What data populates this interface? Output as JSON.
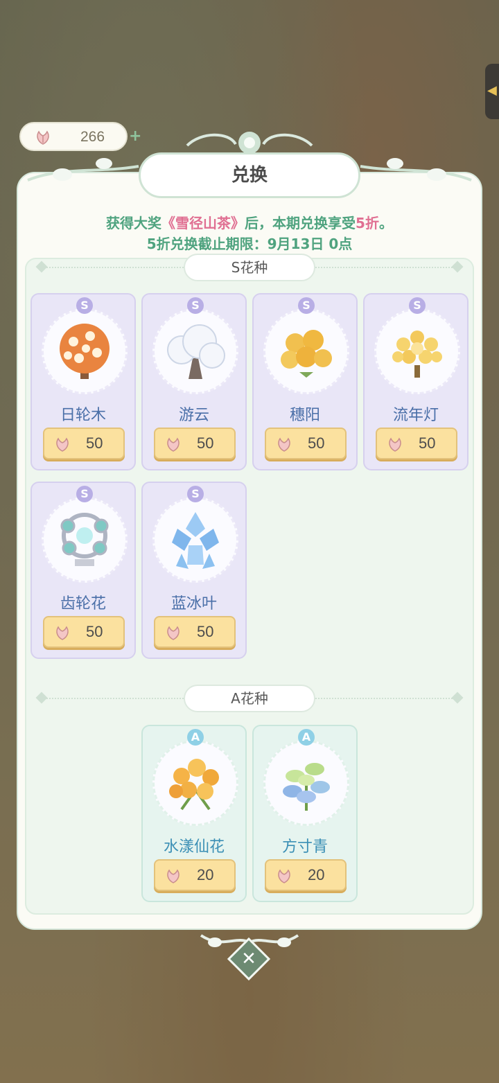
{
  "header": {
    "currency_value": "266",
    "currency_icon": "flower-token-icon",
    "add_icon": "plus-icon"
  },
  "dialog": {
    "title": "兑换",
    "notice_line1_prefix": "获得大奖",
    "notice_line1_prize": "《雪径山茶》",
    "notice_line1_mid": "后，本期兑换享受",
    "notice_line1_discount": "5折",
    "notice_line1_suffix": "。",
    "notice_line2": "5折兑换截止期限：9月13日 0点",
    "close_icon": "close-icon"
  },
  "sections": [
    {
      "title": "S花种",
      "items": [
        {
          "grade": "S",
          "name": "日轮木",
          "price": "50"
        },
        {
          "grade": "S",
          "name": "游云",
          "price": "50"
        },
        {
          "grade": "S",
          "name": "穗阳",
          "price": "50"
        },
        {
          "grade": "S",
          "name": "流年灯",
          "price": "50"
        },
        {
          "grade": "S",
          "name": "齿轮花",
          "price": "50"
        },
        {
          "grade": "S",
          "name": "蓝冰叶",
          "price": "50"
        }
      ]
    },
    {
      "title": "A花种",
      "items": [
        {
          "grade": "A",
          "name": "水漾仙花",
          "price": "20"
        },
        {
          "grade": "A",
          "name": "方寸青",
          "price": "20"
        }
      ]
    }
  ],
  "colors": {
    "accent_green": "#4fa37f",
    "highlight_pink": "#e06f92",
    "price_gold": "#fbe19f"
  }
}
